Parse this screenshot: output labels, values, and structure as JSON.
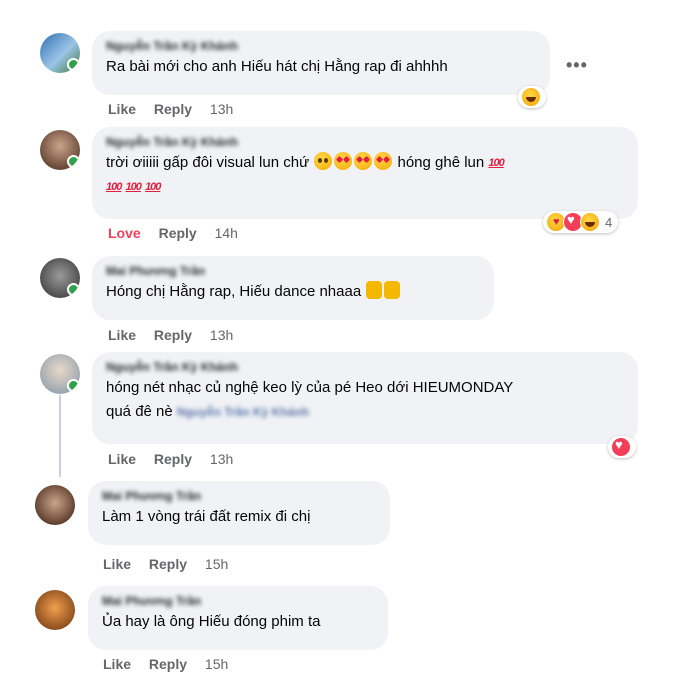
{
  "comments": [
    {
      "name": "Nguyễn Trần Kỳ Khánh",
      "text": "Ra bài mới cho anh Hiếu hát chị Hằng rap đi ahhhh",
      "actions": {
        "like": "Like",
        "reply": "Reply",
        "time": "13h"
      }
    },
    {
      "name": "Nguyễn Trần Kỳ Khánh",
      "text_line1_a": "trời ơiiiii gấp đôi visual lun chứ",
      "text_line1_b": "hóng ghê lun",
      "hundred": "100",
      "actions": {
        "love": "Love",
        "reply": "Reply",
        "time": "14h"
      },
      "reaction_count": "4"
    },
    {
      "name": "Mai Phương Trần",
      "text": "Hóng chị Hằng rap, Hiếu dance nhaaa",
      "actions": {
        "like": "Like",
        "reply": "Reply",
        "time": "13h"
      }
    },
    {
      "name": "Nguyễn Trần Kỳ Khánh",
      "text_line1": "hóng nét nhạc củ nghệ keo lỳ của pé Heo dới HIEUMONDAY",
      "text_line2": "quá đê nè",
      "tagged_name": "Nguyễn Trần Kỳ Khánh",
      "actions": {
        "like": "Like",
        "reply": "Reply",
        "time": "13h"
      }
    },
    {
      "name": "Mai Phương Trần",
      "text": "Làm 1 vòng trái đất remix đi chị",
      "actions": {
        "like": "Like",
        "reply": "Reply",
        "time": "15h"
      }
    },
    {
      "name": "Mai Phương Trần",
      "text": "Ủa hay là ông Hiếu đóng phim ta",
      "actions": {
        "like": "Like",
        "reply": "Reply",
        "time": "15h"
      }
    }
  ],
  "more_label": "•••",
  "colors": {
    "bubble": "#f0f2f5",
    "meta": "#65676b",
    "love": "#f33e58",
    "online": "#31a24c"
  }
}
